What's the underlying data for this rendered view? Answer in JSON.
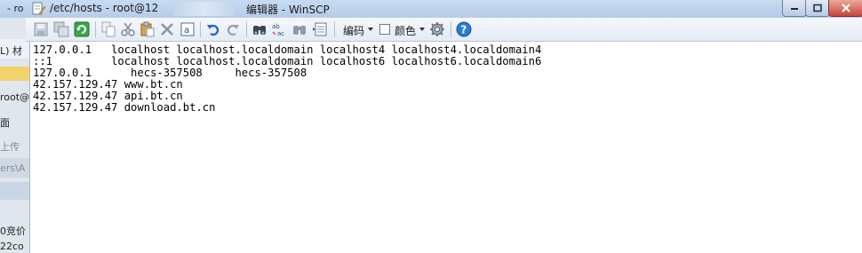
{
  "window": {
    "title_prefix": "/etc/hosts - root@12",
    "title_suffix": "编辑器 - WinSCP"
  },
  "toolbar": {
    "encoding_label": "编码",
    "color_label": "颜色"
  },
  "editor": {
    "lines": [
      "127.0.0.1   localhost localhost.localdomain localhost4 localhost4.localdomain4",
      "::1         localhost localhost.localdomain localhost6 localhost6.localdomain6",
      "127.0.0.1      hecs-357508     hecs-357508",
      "42.157.129.47 www.bt.cn",
      "42.157.129.47 api.bt.cn",
      "42.157.129.47 download.bt.cn"
    ]
  },
  "background_window": {
    "rows": [
      "- ro",
      "L)  材",
      "",
      "root@",
      "面",
      "上传",
      "ers\\A",
      "",
      "",
      "0竞价",
      "22co"
    ]
  },
  "colors": {
    "titlebar": "#c7daf0",
    "toolbar": "#eef2f8",
    "editor_bg": "#ffffff",
    "help_icon": "#2a7bd6"
  }
}
